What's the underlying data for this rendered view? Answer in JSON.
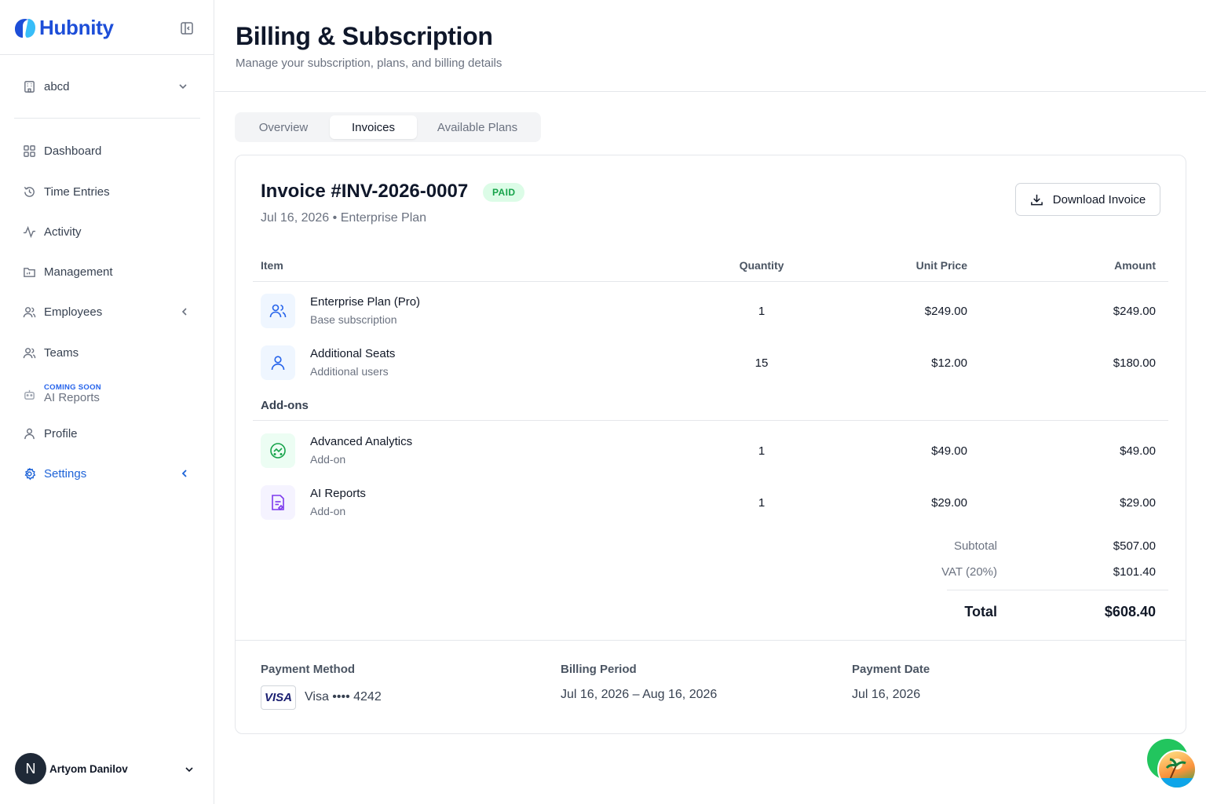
{
  "app": {
    "name": "Hubnity"
  },
  "sidebar": {
    "workspace": "abcd",
    "items": [
      {
        "label": "Dashboard"
      },
      {
        "label": "Time Entries"
      },
      {
        "label": "Activity"
      },
      {
        "label": "Management"
      },
      {
        "label": "Employees"
      },
      {
        "label": "Teams"
      },
      {
        "label": "AI Reports",
        "badge": "COMING SOON"
      },
      {
        "label": "Profile"
      },
      {
        "label": "Settings"
      }
    ],
    "user": {
      "initial": "N",
      "name": "Artyom Danilov"
    }
  },
  "header": {
    "title": "Billing & Subscription",
    "subtitle": "Manage your subscription, plans, and billing details"
  },
  "tabs": [
    {
      "label": "Overview"
    },
    {
      "label": "Invoices"
    },
    {
      "label": "Available Plans"
    }
  ],
  "invoice": {
    "title": "Invoice #INV-2026-0007",
    "status": "PAID",
    "date": "Jul 16, 2026",
    "plan": "Enterprise Plan",
    "download_label": "Download Invoice",
    "columns": {
      "item": "Item",
      "quantity": "Quantity",
      "unit_price": "Unit Price",
      "amount": "Amount"
    },
    "items": [
      {
        "name": "Enterprise Plan (Pro)",
        "desc": "Base subscription",
        "qty": "1",
        "price": "$249.00",
        "amount": "$249.00",
        "icon": "users-icon"
      },
      {
        "name": "Additional Seats",
        "desc": "Additional users",
        "qty": "15",
        "price": "$12.00",
        "amount": "$180.00",
        "icon": "user-icon"
      }
    ],
    "addons_label": "Add-ons",
    "addons": [
      {
        "name": "Advanced Analytics",
        "desc": "Add-on",
        "qty": "1",
        "price": "$49.00",
        "amount": "$49.00",
        "icon": "analytics-icon"
      },
      {
        "name": "AI Reports",
        "desc": "Add-on",
        "qty": "1",
        "price": "$29.00",
        "amount": "$29.00",
        "icon": "report-icon"
      }
    ],
    "summary": {
      "subtotal_label": "Subtotal",
      "subtotal": "$507.00",
      "vat_label": "VAT (20%)",
      "vat": "$101.40",
      "total_label": "Total",
      "total": "$608.40"
    },
    "footer": {
      "payment_method_label": "Payment Method",
      "card_brand": "VISA",
      "card_text": "Visa •••• 4242",
      "billing_period_label": "Billing Period",
      "billing_period": "Jul 16, 2026 – Aug 16, 2026",
      "payment_date_label": "Payment Date",
      "payment_date": "Jul 16, 2026"
    }
  },
  "colors": {
    "accent": "#1d63d8",
    "paid_bg": "#dcfce7",
    "paid_text": "#16a34a"
  }
}
